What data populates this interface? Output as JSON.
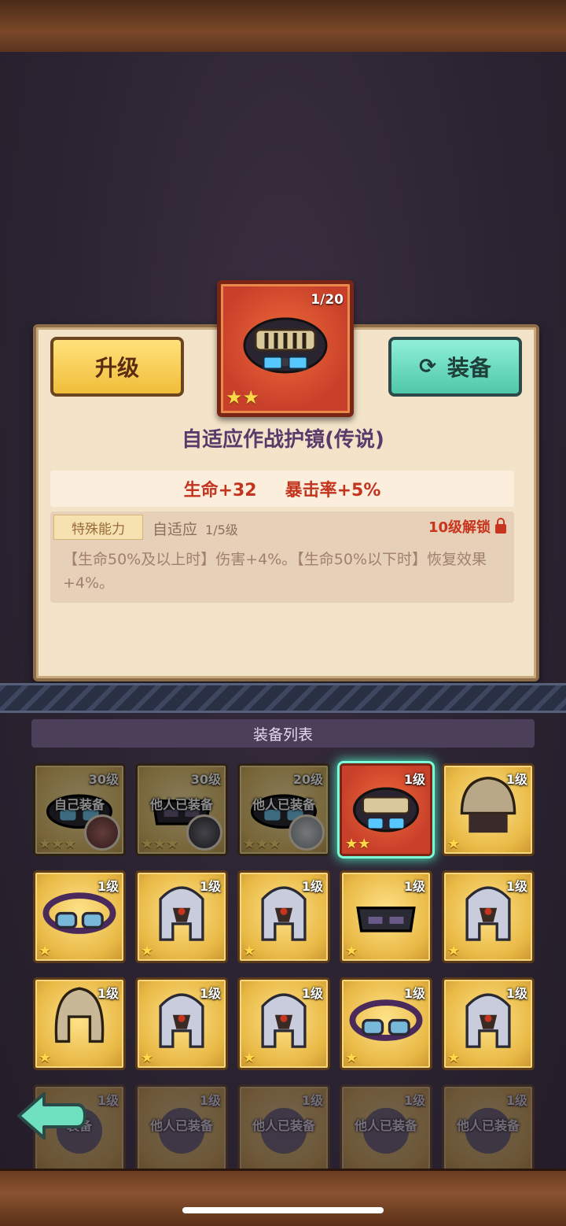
{
  "item": {
    "count": "1/20",
    "stars": "★★",
    "name": "自适应作战护镜(传说)",
    "stats": [
      "生命+32",
      "暴击率+5%"
    ],
    "ability": {
      "tag": "特殊能力",
      "name": "自适应",
      "level": "1/5级",
      "unlock": "10级解锁",
      "description": "【生命50%及以上时】伤害+4%。【生命50%以下时】恢复效果+4%。"
    }
  },
  "buttons": {
    "upgrade": "升级",
    "equip": "装备"
  },
  "list": {
    "header": "装备列表",
    "slots": [
      {
        "level": "30级",
        "owner": "自己装备",
        "stars": "★★★",
        "icon": "goggles-dark"
      },
      {
        "level": "30级",
        "owner": "他人已装备",
        "stars": "★★★",
        "icon": "mask-dark"
      },
      {
        "level": "20级",
        "owner": "他人已装备",
        "stars": "★★★",
        "icon": "goggles-dark"
      },
      {
        "level": "1级",
        "owner": "",
        "stars": "★★",
        "icon": "combat-goggles",
        "selected": true
      },
      {
        "level": "1级",
        "owner": "",
        "stars": "★",
        "icon": "helmet"
      },
      {
        "level": "1级",
        "owner": "",
        "stars": "★",
        "icon": "goggles"
      },
      {
        "level": "1级",
        "owner": "",
        "stars": "★",
        "icon": "knight-helmet"
      },
      {
        "level": "1级",
        "owner": "",
        "stars": "★",
        "icon": "knight-helmet"
      },
      {
        "level": "1级",
        "owner": "",
        "stars": "★",
        "icon": "mask-dark"
      },
      {
        "level": "1级",
        "owner": "",
        "stars": "★",
        "icon": "knight-helmet"
      },
      {
        "level": "1级",
        "owner": "",
        "stars": "★",
        "icon": "spartan-helmet"
      },
      {
        "level": "1级",
        "owner": "",
        "stars": "★",
        "icon": "knight-helmet"
      },
      {
        "level": "1级",
        "owner": "",
        "stars": "★",
        "icon": "knight-helmet"
      },
      {
        "level": "1级",
        "owner": "",
        "stars": "★",
        "icon": "goggles"
      },
      {
        "level": "1级",
        "owner": "",
        "stars": "★",
        "icon": "knight-helmet"
      },
      {
        "level": "1级",
        "owner": "装备",
        "stars": "",
        "icon": "faded"
      },
      {
        "level": "1级",
        "owner": "他人已装备",
        "stars": "",
        "icon": "faded"
      },
      {
        "level": "1级",
        "owner": "他人已装备",
        "stars": "",
        "icon": "faded"
      },
      {
        "level": "1级",
        "owner": "他人已装备",
        "stars": "",
        "icon": "faded"
      },
      {
        "level": "1级",
        "owner": "他人已装备",
        "stars": "",
        "icon": "faded"
      }
    ]
  },
  "colors": {
    "stat_red": "#c2341e",
    "gold_slot": "#e8b844",
    "selected_glow": "#4de0b8"
  }
}
